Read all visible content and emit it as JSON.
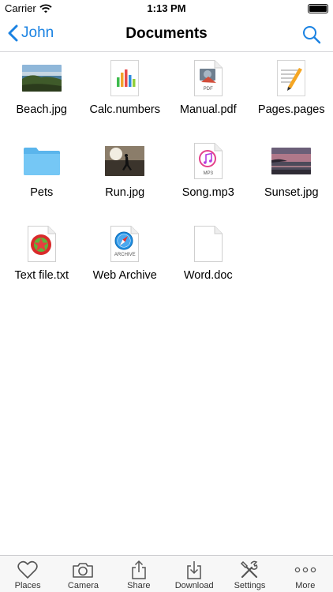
{
  "status_bar": {
    "carrier": "Carrier",
    "time": "1:13 PM"
  },
  "navbar": {
    "back_label": "John",
    "title": "Documents"
  },
  "files": [
    {
      "name": "Beach.jpg",
      "icon": "photo-beach"
    },
    {
      "name": "Calc.numbers",
      "icon": "numbers-icon"
    },
    {
      "name": "Manual.pdf",
      "icon": "pdf-icon",
      "badge": "PDF"
    },
    {
      "name": "Pages.pages",
      "icon": "pages-icon"
    },
    {
      "name": "Pets",
      "icon": "folder-icon"
    },
    {
      "name": "Run.jpg",
      "icon": "photo-run"
    },
    {
      "name": "Song.mp3",
      "icon": "mp3-icon",
      "badge": "MP3"
    },
    {
      "name": "Sunset.jpg",
      "icon": "photo-sunset"
    },
    {
      "name": "Text file.txt",
      "icon": "text-file-icon"
    },
    {
      "name": "Web Archive",
      "icon": "web-archive-icon",
      "badge": "ARCHIVE"
    },
    {
      "name": "Word.doc",
      "icon": "blank-doc-icon"
    }
  ],
  "tabbar": {
    "items": [
      {
        "label": "Places",
        "icon": "heart-icon"
      },
      {
        "label": "Camera",
        "icon": "camera-icon"
      },
      {
        "label": "Share",
        "icon": "share-icon"
      },
      {
        "label": "Download",
        "icon": "download-icon"
      },
      {
        "label": "Settings",
        "icon": "tools-icon"
      },
      {
        "label": "More",
        "icon": "more-icon"
      }
    ]
  },
  "colors": {
    "accent": "#1a82e2",
    "folder": "#6ec3f5",
    "bar_bg": "#f7f7f7"
  }
}
